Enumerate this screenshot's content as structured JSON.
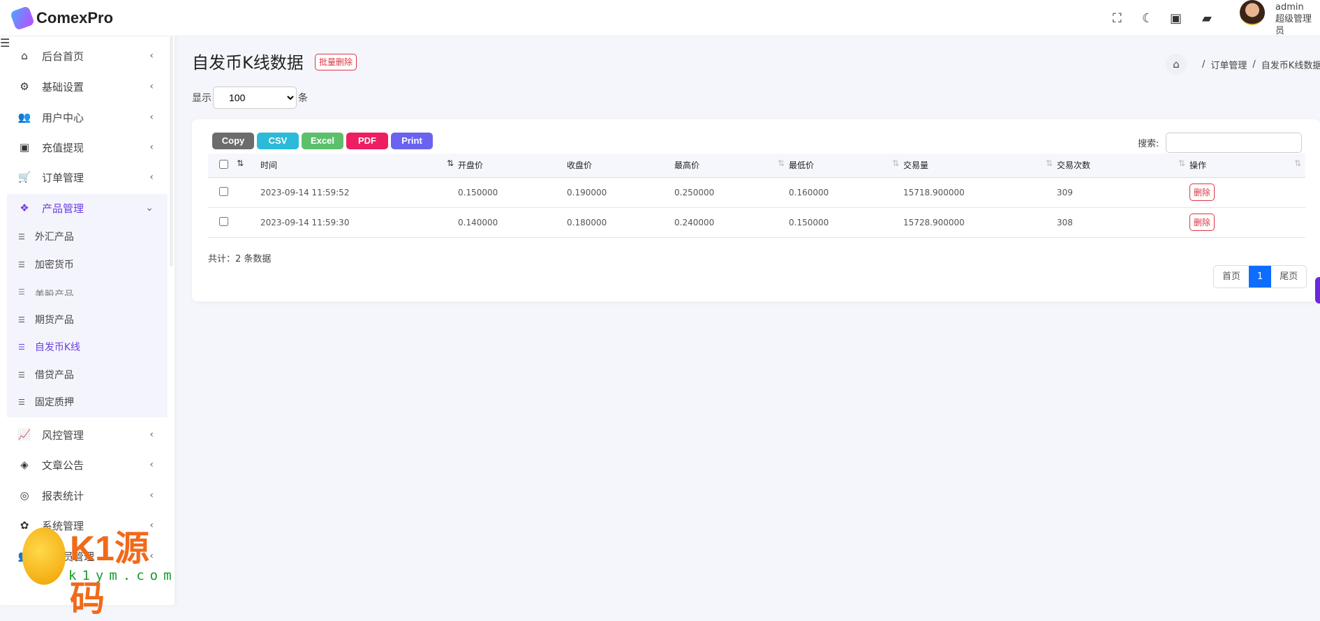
{
  "brand": {
    "name": "ComexPro"
  },
  "sidebar": {
    "items": [
      {
        "label": "后台首页",
        "icon": "home-icon"
      },
      {
        "label": "基础设置",
        "icon": "gears-icon"
      },
      {
        "label": "用户中心",
        "icon": "users-icon"
      },
      {
        "label": "充值提现",
        "icon": "money-icon"
      },
      {
        "label": "订单管理",
        "icon": "cart-icon"
      },
      {
        "label": "产品管理",
        "icon": "cubes-icon",
        "expanded": true
      },
      {
        "label": "风控管理",
        "icon": "chart-line-icon"
      },
      {
        "label": "文章公告",
        "icon": "layers-icon"
      },
      {
        "label": "报表统计",
        "icon": "coins-icon"
      },
      {
        "label": "系统管理",
        "icon": "cog-icon"
      },
      {
        "label": "管理员管理",
        "icon": "users-cog-icon"
      }
    ],
    "submenu": [
      {
        "label": "外汇产品"
      },
      {
        "label": "加密货币"
      },
      {
        "label": "美股产品"
      },
      {
        "label": "期货产品"
      },
      {
        "label": "自发币K线",
        "active": true
      },
      {
        "label": "借贷产品"
      },
      {
        "label": "固定质押"
      }
    ]
  },
  "header": {
    "user_name": "admin",
    "user_role": "超级管理员"
  },
  "page": {
    "title": "自发币K线数据",
    "batch_delete": "批量删除",
    "breadcrumb": [
      "订单管理",
      "自发币K线数据"
    ],
    "show_label": "显示",
    "page_size": "100",
    "unit_label": "条"
  },
  "toolbar": {
    "buttons": [
      {
        "label": "Copy",
        "color": "#6c6c6c"
      },
      {
        "label": "CSV",
        "color": "#2bbbd8"
      },
      {
        "label": "Excel",
        "color": "#5cbf6c"
      },
      {
        "label": "PDF",
        "color": "#ee1e62"
      },
      {
        "label": "Print",
        "color": "#6a63f0"
      }
    ],
    "search_label": "搜索:"
  },
  "table": {
    "columns": [
      "时间",
      "开盘价",
      "收盘价",
      "最高价",
      "最低价",
      "交易量",
      "交易次数",
      "操作"
    ],
    "rows": [
      {
        "time": "2023-09-14 11:59:52",
        "open": "0.150000",
        "close": "0.190000",
        "high": "0.250000",
        "low": "0.160000",
        "volume": "15718.900000",
        "count": "309",
        "action": "删除"
      },
      {
        "time": "2023-09-14 11:59:30",
        "open": "0.140000",
        "close": "0.180000",
        "high": "0.240000",
        "low": "0.150000",
        "volume": "15728.900000",
        "count": "308",
        "action": "删除"
      }
    ]
  },
  "footer": {
    "total": "共计：2 条数据",
    "first": "首页",
    "current": "1",
    "last": "尾页"
  },
  "watermark": {
    "text": "K1源码",
    "url": "k1ym.com"
  }
}
